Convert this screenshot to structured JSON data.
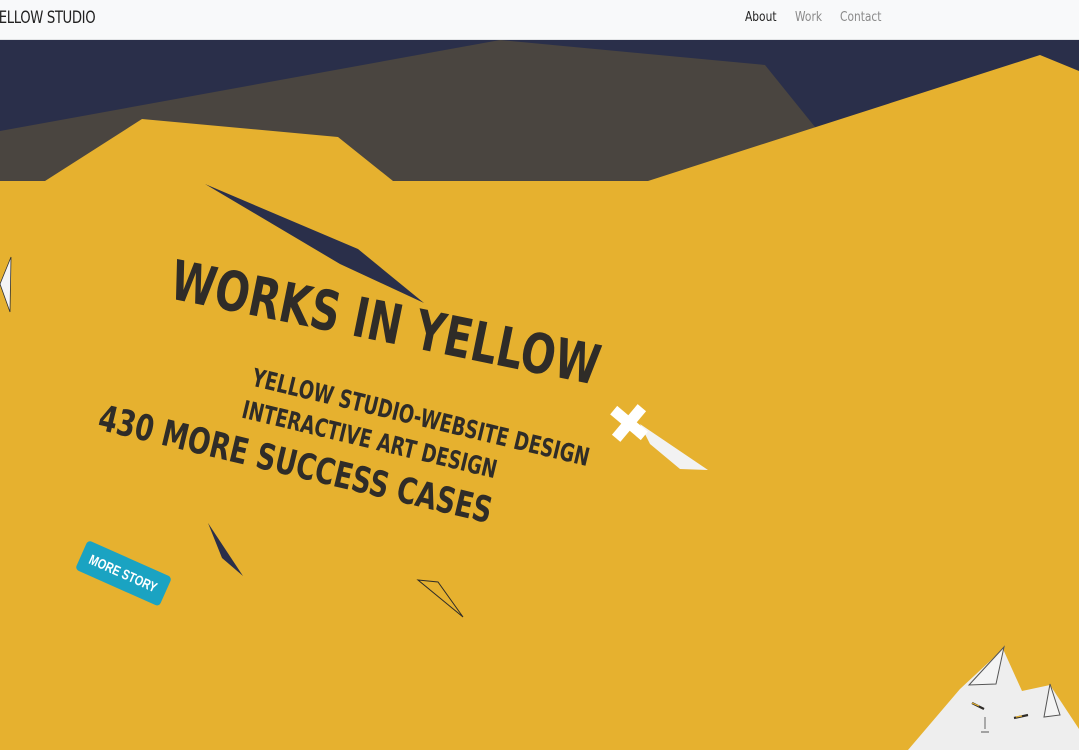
{
  "nav": {
    "brand": "YELLOW STUDIO",
    "links": [
      {
        "label": "About",
        "active": true
      },
      {
        "label": "Work",
        "active": false
      },
      {
        "label": "Contact",
        "active": false
      }
    ]
  },
  "hero": {
    "title": "WORKS IN YELLOW",
    "subtitle_lines": [
      "YELLOW STUDIO-WEBSITE DESIGN",
      "INTERACTIVE ART DESIGN",
      "430 MORE SUCCESS CASES"
    ],
    "cta_label": "MORE STORY"
  },
  "colors": {
    "background": "#e6b12f",
    "sky": "#2a2f4a",
    "mountain": "#4a4540",
    "text": "#2f2c28",
    "button": "#1aa3c2"
  }
}
